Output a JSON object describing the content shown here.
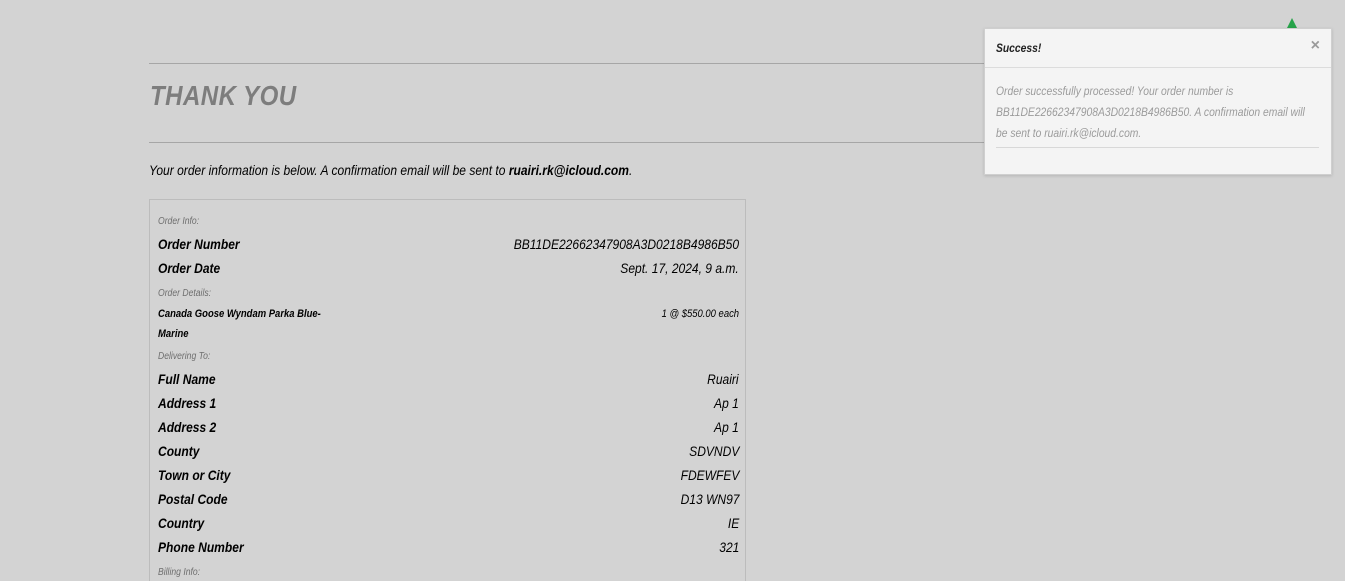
{
  "page": {
    "title": "THANK YOU",
    "intro_text": "Your order information is below. A confirmation email will be sent to ",
    "intro_email": "ruairi.rk@icloud.com",
    "intro_end": "."
  },
  "order": {
    "info_label": "Order Info:",
    "order_number_label": "Order Number",
    "order_number": "BB11DE22662347908A3D0218B4986B50",
    "order_date_label": "Order Date",
    "order_date": "Sept. 17, 2024, 9 a.m.",
    "details_label": "Order Details:",
    "product_name": "Canada Goose Wyndam Parka Blue-Marine",
    "product_qty": "1 @ $550.00 each",
    "delivering_label": "Delivering To:",
    "delivery": [
      {
        "label": "Full Name",
        "value": "Ruairi"
      },
      {
        "label": "Address 1",
        "value": "Ap 1"
      },
      {
        "label": "Address 2",
        "value": "Ap 1"
      },
      {
        "label": "County",
        "value": "SDVNDV"
      },
      {
        "label": "Town or City",
        "value": "FDEWFEV"
      },
      {
        "label": "Postal Code",
        "value": "D13 WN97"
      },
      {
        "label": "Country",
        "value": "IE"
      },
      {
        "label": "Phone Number",
        "value": "321"
      }
    ],
    "billing_label": "Billing Info:"
  },
  "toast": {
    "title": "Success!",
    "close": "×",
    "message": "Order successfully processed! Your order number is BB11DE22662347908A3D0218B4986B50. A confirmation email will be sent to ruairi.rk@icloud.com."
  },
  "colors": {
    "background": "#d3d3d3",
    "toast_arrow": "#27a34a"
  }
}
